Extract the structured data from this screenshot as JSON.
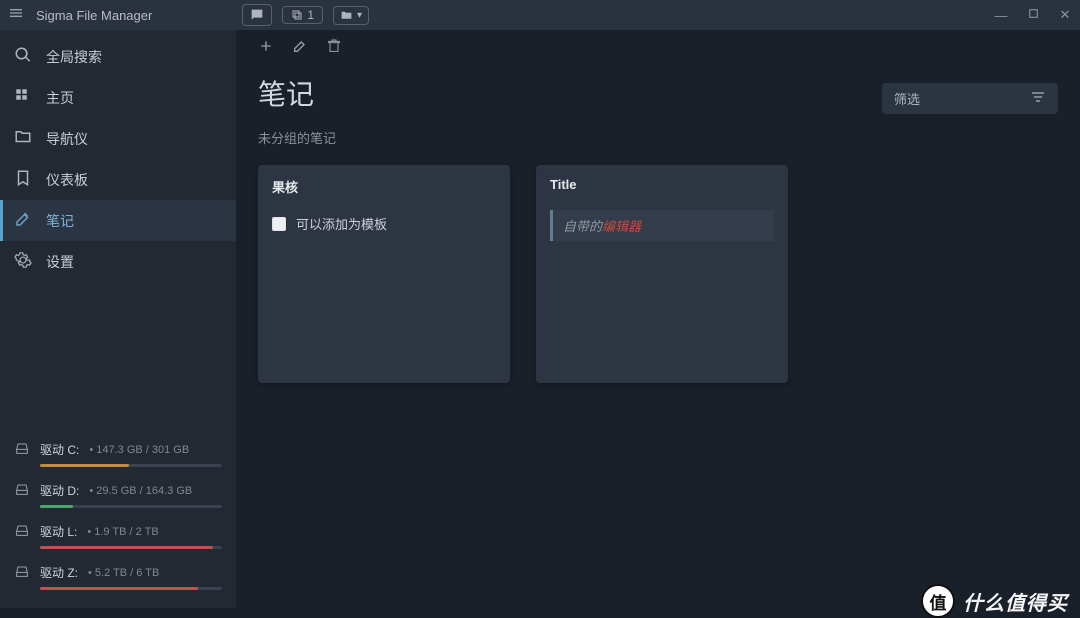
{
  "titlebar": {
    "app_name": "Sigma File Manager",
    "tab_count": "1"
  },
  "sidebar": {
    "items": [
      {
        "icon": "search-icon",
        "label": "全局搜索"
      },
      {
        "icon": "home-grid-icon",
        "label": "主页"
      },
      {
        "icon": "folder-icon",
        "label": "导航仪"
      },
      {
        "icon": "bookmark-icon",
        "label": "仪表板"
      },
      {
        "icon": "note-edit-icon",
        "label": "笔记",
        "active": true
      },
      {
        "icon": "gear-icon",
        "label": "设置"
      }
    ]
  },
  "drives": [
    {
      "label": "驱动 C:",
      "stats": "• 147.3 GB / 301 GB",
      "pct": 49,
      "color": "#c58a3a"
    },
    {
      "label": "驱动 D:",
      "stats": "• 29.5 GB / 164.3 GB",
      "pct": 18,
      "color": "#4aa66f"
    },
    {
      "label": "驱动 L:",
      "stats": "• 1.9 TB / 2 TB",
      "pct": 95,
      "color": "#c25050"
    },
    {
      "label": "驱动 Z:",
      "stats": "• 5.2 TB / 6 TB",
      "pct": 87,
      "color": "#c25050"
    }
  ],
  "main": {
    "page_title": "笔记",
    "filter_label": "筛选",
    "subheading": "未分组的笔记",
    "cards": [
      {
        "title": "果核",
        "type": "checklist",
        "item": "可以添加为模板"
      },
      {
        "title": "Title",
        "type": "quote",
        "quote_plain": "自带的",
        "quote_red": "编辑器"
      }
    ]
  },
  "watermark": {
    "badge": "值",
    "text": "什么值得买"
  }
}
